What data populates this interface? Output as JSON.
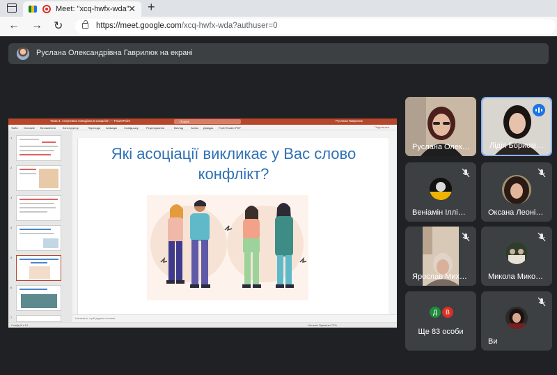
{
  "browser": {
    "tab_title": "Meet: \"xcq-hwfx-wda\"",
    "tab_close": "✕",
    "new_tab": "+",
    "url_host": "https://meet.google.com",
    "url_path": "/xcq-hwfx-wda?authuser=0"
  },
  "meet": {
    "presenter_banner": "Руслана Олександрівна Гаврилюк на екрані",
    "participants": [
      {
        "name": "Руслана Олек…",
        "muted": false,
        "speaking": false
      },
      {
        "name": "Лідія Борисів…",
        "muted": false,
        "speaking": true
      },
      {
        "name": "Веніамін Іллі…",
        "muted": true
      },
      {
        "name": "Оксана Леоні…",
        "muted": true
      },
      {
        "name": "Ярослав Мих…",
        "muted": true
      },
      {
        "name": "Микола Мико…",
        "muted": true
      },
      {
        "name": "Ви",
        "muted": true
      }
    ],
    "more": {
      "label": "Ще 83 особи",
      "initials": [
        "Д",
        "В"
      ],
      "colors": [
        "#1e8e3e",
        "#d93025"
      ]
    }
  },
  "presentation": {
    "app_title": "Тема 3. Асертивна поведінка в конфлікті — PowerPoint",
    "search_placeholder": "Пошук",
    "user": "Руслана Гаврилюк",
    "ribbon_tabs": [
      "Файл",
      "Основне",
      "Вставлення",
      "Конструктор",
      "Переходи",
      "Анімація",
      "Слайд-шоу",
      "Рецензування",
      "Вигляд",
      "Запис",
      "Довідка",
      "Foxit Reader PDF"
    ],
    "share_label": "Поділитися",
    "active_slide": 5,
    "slide_title": "Які асоціації викликає у Вас слово конфлікт?",
    "notes_placeholder": "Натисніть, щоб додати нотатки",
    "status_left": "Слайд 5 з 14",
    "status_right": "Нотатки    Примітки    72%"
  }
}
